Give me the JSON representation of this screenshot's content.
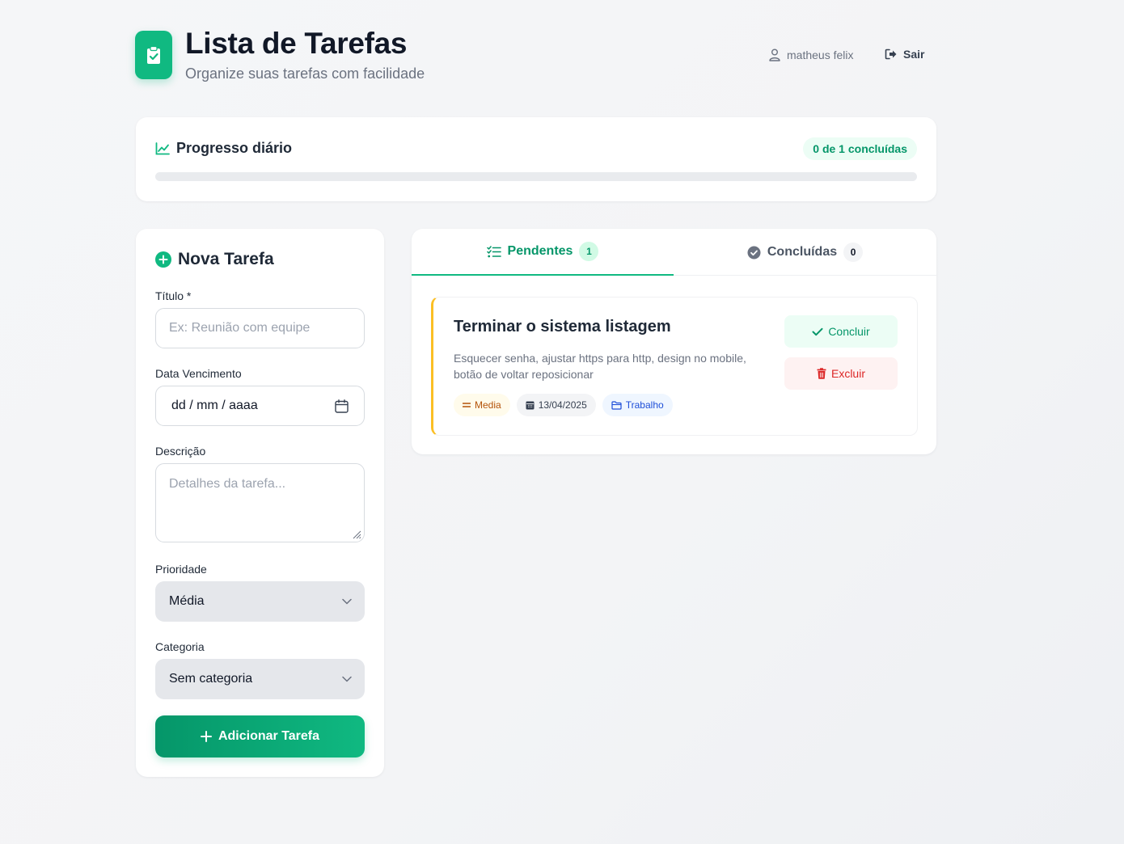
{
  "header": {
    "title": "Lista de Tarefas",
    "subtitle": "Organize suas tarefas com facilidade",
    "user_name": "matheus felix",
    "logout_label": "Sair"
  },
  "progress": {
    "title": "Progresso diário",
    "badge": "0 de 1 concluídas",
    "completed": 0,
    "total": 1,
    "fraction": 0
  },
  "form": {
    "title": "Nova Tarefa",
    "title_label": "Título *",
    "title_placeholder": "Ex: Reunião com equipe",
    "date_label": "Data Vencimento",
    "date_placeholder": "dd / mm / aaaa",
    "description_label": "Descrição",
    "description_placeholder": "Detalhes da tarefa...",
    "priority_label": "Prioridade",
    "priority_value": "Média",
    "category_label": "Categoria",
    "category_value": "Sem categoria",
    "submit_label": "Adicionar Tarefa"
  },
  "tabs": {
    "pending_label": "Pendentes",
    "pending_count": "1",
    "done_label": "Concluídas",
    "done_count": "0"
  },
  "tasks": [
    {
      "title": "Terminar o sistema listagem",
      "description": "Esquecer senha, ajustar https para http, design no mobile, botão de voltar reposicionar",
      "priority": "Media",
      "due_date": "13/04/2025",
      "category": "Trabalho",
      "conclude_label": "Concluir",
      "delete_label": "Excluir"
    }
  ],
  "colors": {
    "accent": "#10b981",
    "accent_dark": "#059669",
    "priority_medium": "#fbbf24",
    "danger": "#dc2626"
  },
  "icons": {
    "logo": "clipboard-check-icon",
    "user": "user-icon",
    "logout": "sign-out-icon",
    "progress": "chart-line-icon",
    "new_task": "plus-circle-icon",
    "calendar": "calendar-icon",
    "pending_tab": "list-check-icon",
    "done_tab": "check-circle-icon",
    "conclude": "check-icon",
    "delete": "trash-icon",
    "priority_tag": "equals-icon",
    "date_tag": "calendar-icon",
    "category_tag": "folder-icon",
    "submit": "plus-icon"
  }
}
